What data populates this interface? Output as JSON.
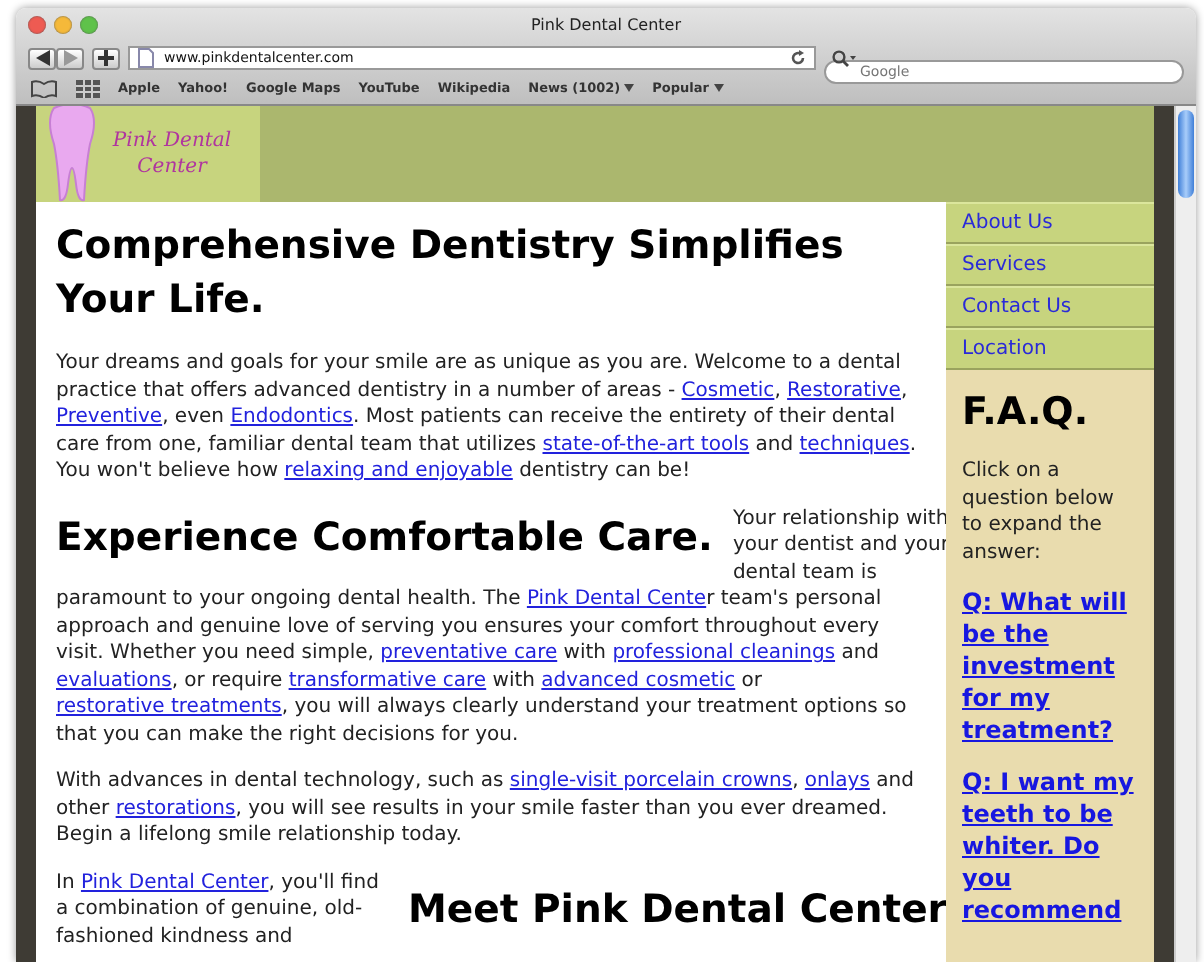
{
  "window": {
    "title": "Pink Dental Center"
  },
  "toolbar": {
    "url": "www.pinkdentalcenter.com",
    "search_placeholder": "Google"
  },
  "bookmarks": [
    {
      "label": "Apple",
      "menu": false
    },
    {
      "label": "Yahoo!",
      "menu": false
    },
    {
      "label": "Google Maps",
      "menu": false
    },
    {
      "label": "YouTube",
      "menu": false
    },
    {
      "label": "Wikipedia",
      "menu": false
    },
    {
      "label": "News (1002)",
      "menu": true
    },
    {
      "label": "Popular",
      "menu": true
    }
  ],
  "logo": {
    "text": "Pink Dental Center"
  },
  "main": [
    {
      "kind": "heading",
      "text": "Comprehensive Dentistry Simplifies Your Life."
    },
    {
      "kind": "paragraph",
      "parts": [
        {
          "text": "Your dreams and goals for your smile are as unique as you are. Welcome to a dental practice that offers advanced dentistry in a number of areas - ",
          "link": false
        },
        {
          "text": "Cosmetic",
          "link": true
        },
        {
          "text": ", ",
          "link": false
        },
        {
          "text": "Restorative",
          "link": true
        },
        {
          "text": ", ",
          "link": false
        },
        {
          "text": "Preventive",
          "link": true
        },
        {
          "text": ", even ",
          "link": false
        },
        {
          "text": "Endodontics",
          "link": true
        },
        {
          "text": ". Most patients can receive the entirety of their dental care from one, familiar dental team that utilizes ",
          "link": false
        },
        {
          "text": "state-of-the-art tools",
          "link": true
        },
        {
          "text": " and ",
          "link": false
        },
        {
          "text": "techniques",
          "link": true
        },
        {
          "text": ". You won't believe how ",
          "link": false
        },
        {
          "text": "relaxing and enjoyable",
          "link": true
        },
        {
          "text": " dentistry can be!",
          "link": false
        }
      ]
    },
    {
      "kind": "float-heading",
      "text": "Experience Comfortable Care.",
      "intro": "Your relationship with your dentist and your dental team is",
      "parts": [
        {
          "text": "paramount to your ongoing dental health. The ",
          "link": false
        },
        {
          "text": "Pink Dental Cente",
          "link": true
        },
        {
          "text": "r team's personal approach and genuine love of serving you ensures your comfort throughout every visit. Whether you need simple, ",
          "link": false
        },
        {
          "text": "preventative care",
          "link": true
        },
        {
          "text": " with ",
          "link": false
        },
        {
          "text": "professional cleanings",
          "link": true
        },
        {
          "text": " and ",
          "link": false
        },
        {
          "text": "evaluations",
          "link": true
        },
        {
          "text": ", or require ",
          "link": false
        },
        {
          "text": "transformative care",
          "link": true
        },
        {
          "text": " with ",
          "link": false
        },
        {
          "text": "advanced cosmetic",
          "link": true
        },
        {
          "text": " or ",
          "link": false
        },
        {
          "text": "restorative treatments",
          "link": true
        },
        {
          "text": ", you will always clearly understand your treatment options so that you can make the right decisions for you.",
          "link": false
        }
      ]
    },
    {
      "kind": "paragraph",
      "parts": [
        {
          "text": "With advances in dental technology, such as ",
          "link": false
        },
        {
          "text": "single-visit porcelain crowns",
          "link": true
        },
        {
          "text": ", ",
          "link": false
        },
        {
          "text": "onlays",
          "link": true
        },
        {
          "text": " and other ",
          "link": false
        },
        {
          "text": "restorations",
          "link": true
        },
        {
          "text": ", you will see results in your smile faster than you ever dreamed. Begin a lifelong smile relationship today.",
          "link": false
        }
      ]
    },
    {
      "kind": "side-heading",
      "text": "Meet Pink Dental Center",
      "parts": [
        {
          "text": "In ",
          "link": false
        },
        {
          "text": "Pink Dental Center",
          "link": true
        },
        {
          "text": ", you'll find a combination of genuine, old-fashioned kindness and",
          "link": false
        }
      ]
    }
  ],
  "sidebar": {
    "nav": [
      "About Us",
      "Services",
      "Contact Us",
      "Location"
    ],
    "faq_title": "F.A.Q.",
    "faq_intro": "Click on a question below to expand the answer:",
    "questions": [
      "Q: What will be the investment for my treatment?",
      "Q: I want my teeth to be whiter. Do you recommend"
    ]
  }
}
